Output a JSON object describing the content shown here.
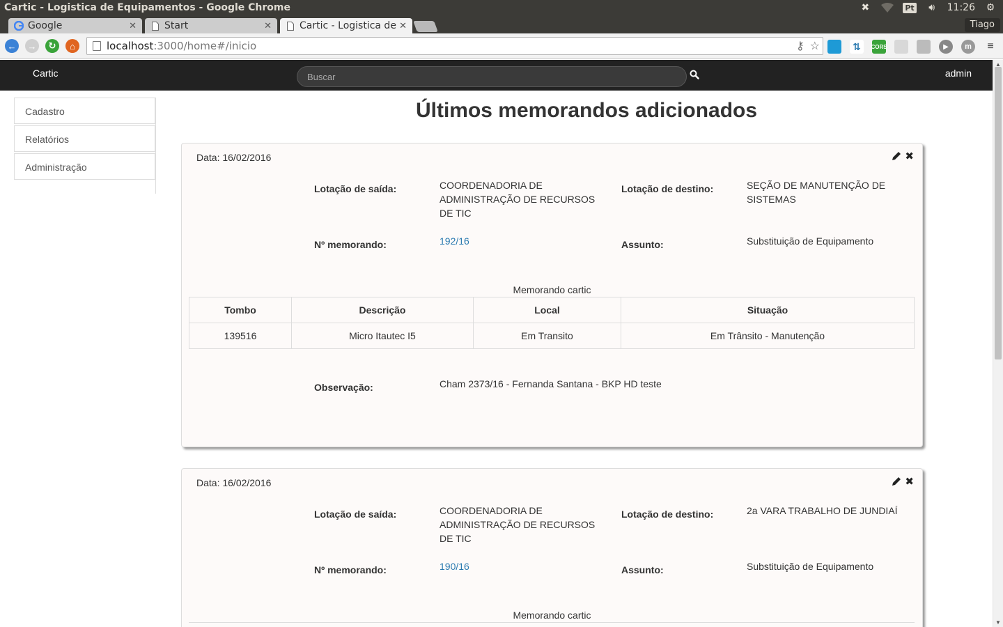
{
  "os": {
    "title": "Cartic - Logistica de Equipamentos - Google Chrome",
    "keyboard": "Pt",
    "clock": "11:26"
  },
  "browser": {
    "tabs": [
      {
        "label": "Google",
        "icon": "google-icon"
      },
      {
        "label": "Start",
        "icon": "page-icon"
      },
      {
        "label": "Cartic - Logistica de Equipamentos",
        "icon": "page-icon"
      }
    ],
    "profile": "Tiago",
    "url_host": "localhost",
    "url_path": ":3000/home#/inicio"
  },
  "navbar": {
    "brand": "Cartic",
    "search_placeholder": "Buscar",
    "user": "admin"
  },
  "sidebar": {
    "items": [
      {
        "label": "Cadastro"
      },
      {
        "label": "Relatórios"
      },
      {
        "label": "Administração"
      }
    ]
  },
  "main": {
    "title": "Últimos memorandos adicionados",
    "labels": {
      "saida": "Lotação de saída:",
      "destino": "Lotação de destino:",
      "numero": "Nº memorando:",
      "assunto": "Assunto:",
      "observacao": "Observação:",
      "caption": "Memorando cartic"
    },
    "table_headers": [
      "Tombo",
      "Descrição",
      "Local",
      "Situação"
    ],
    "memos": [
      {
        "date": "Data: 16/02/2016",
        "saida": "COORDENADORIA DE ADMINISTRAÇÃO DE RECURSOS DE TIC",
        "destino": "SEÇÃO DE MANUTENÇÃO DE SISTEMAS",
        "numero": "192/16",
        "assunto": "Substituição de Equipamento",
        "rows": [
          [
            "139516",
            "Micro Itautec I5",
            "Em Transito",
            "Em Trânsito - Manutenção"
          ]
        ],
        "observacao": "Cham 2373/16 - Fernanda Santana - BKP HD teste"
      },
      {
        "date": "Data: 16/02/2016",
        "saida": "COORDENADORIA DE ADMINISTRAÇÃO DE RECURSOS DE TIC",
        "destino": "2a VARA TRABALHO DE JUNDIAÍ",
        "numero": "190/16",
        "assunto": "Substituição de Equipamento"
      }
    ]
  }
}
